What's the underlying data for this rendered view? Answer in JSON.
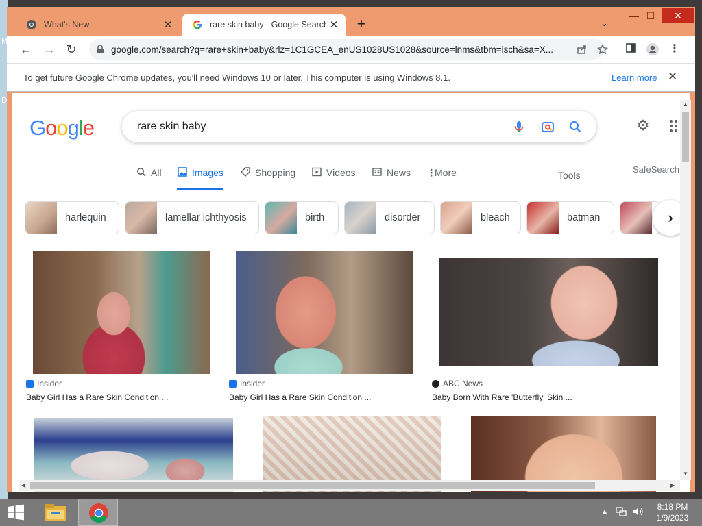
{
  "desktop": {
    "edge_letters": [
      "M",
      "D"
    ]
  },
  "tabs": [
    {
      "title": "What's New",
      "close": "✕"
    },
    {
      "title": "rare skin baby - Google Search",
      "close": "✕"
    }
  ],
  "new_tab": "+",
  "tab_search": "⌄",
  "window_controls": {
    "minimize": "—",
    "maximize": "☐",
    "close": "✕"
  },
  "toolbar": {
    "back": "←",
    "forward": "→",
    "reload": "↻",
    "url": "google.com/search?q=rare+skin+baby&rlz=1C1GCEA_enUS1028US1028&source=lnms&tbm=isch&sa=X...",
    "menu": "⋮"
  },
  "infobar": {
    "message": "To get future Google Chrome updates, you'll need Windows 10 or later. This computer is using Windows 8.1.",
    "learn_more": "Learn more",
    "close": "✕"
  },
  "search": {
    "logo": [
      "G",
      "o",
      "o",
      "g",
      "l",
      "e"
    ],
    "logo_colors": [
      "#4285f4",
      "#ea4335",
      "#fbbc05",
      "#4285f4",
      "#34a853",
      "#ea4335"
    ],
    "query": "rare skin baby"
  },
  "nav_tabs": [
    {
      "label": "All",
      "icon": "search-icon"
    },
    {
      "label": "Images",
      "icon": "image-icon",
      "active": true
    },
    {
      "label": "Shopping",
      "icon": "tag-icon"
    },
    {
      "label": "Videos",
      "icon": "play-icon"
    },
    {
      "label": "News",
      "icon": "news-icon"
    },
    {
      "label": "More",
      "icon": "more-icon"
    }
  ],
  "tools_label": "Tools",
  "safesearch_label": "SafeSearch",
  "chips": [
    "harlequin",
    "lamellar ichthyosis",
    "birth",
    "disorder",
    "bleach",
    "batman",
    ""
  ],
  "chip_next": "›",
  "results": [
    {
      "source": "Insider",
      "source_color": "#1a73e8",
      "caption": "Baby Girl Has a Rare Skin Condition ..."
    },
    {
      "source": "Insider",
      "source_color": "#1a73e8",
      "caption": "Baby Girl Has a Rare Skin Condition ..."
    },
    {
      "source": "ABC News",
      "source_color": "#202124",
      "caption": "Baby Born With Rare 'Butterfly' Skin ..."
    }
  ],
  "clock": {
    "time": "8:18 PM",
    "date": "1/9/2023"
  }
}
